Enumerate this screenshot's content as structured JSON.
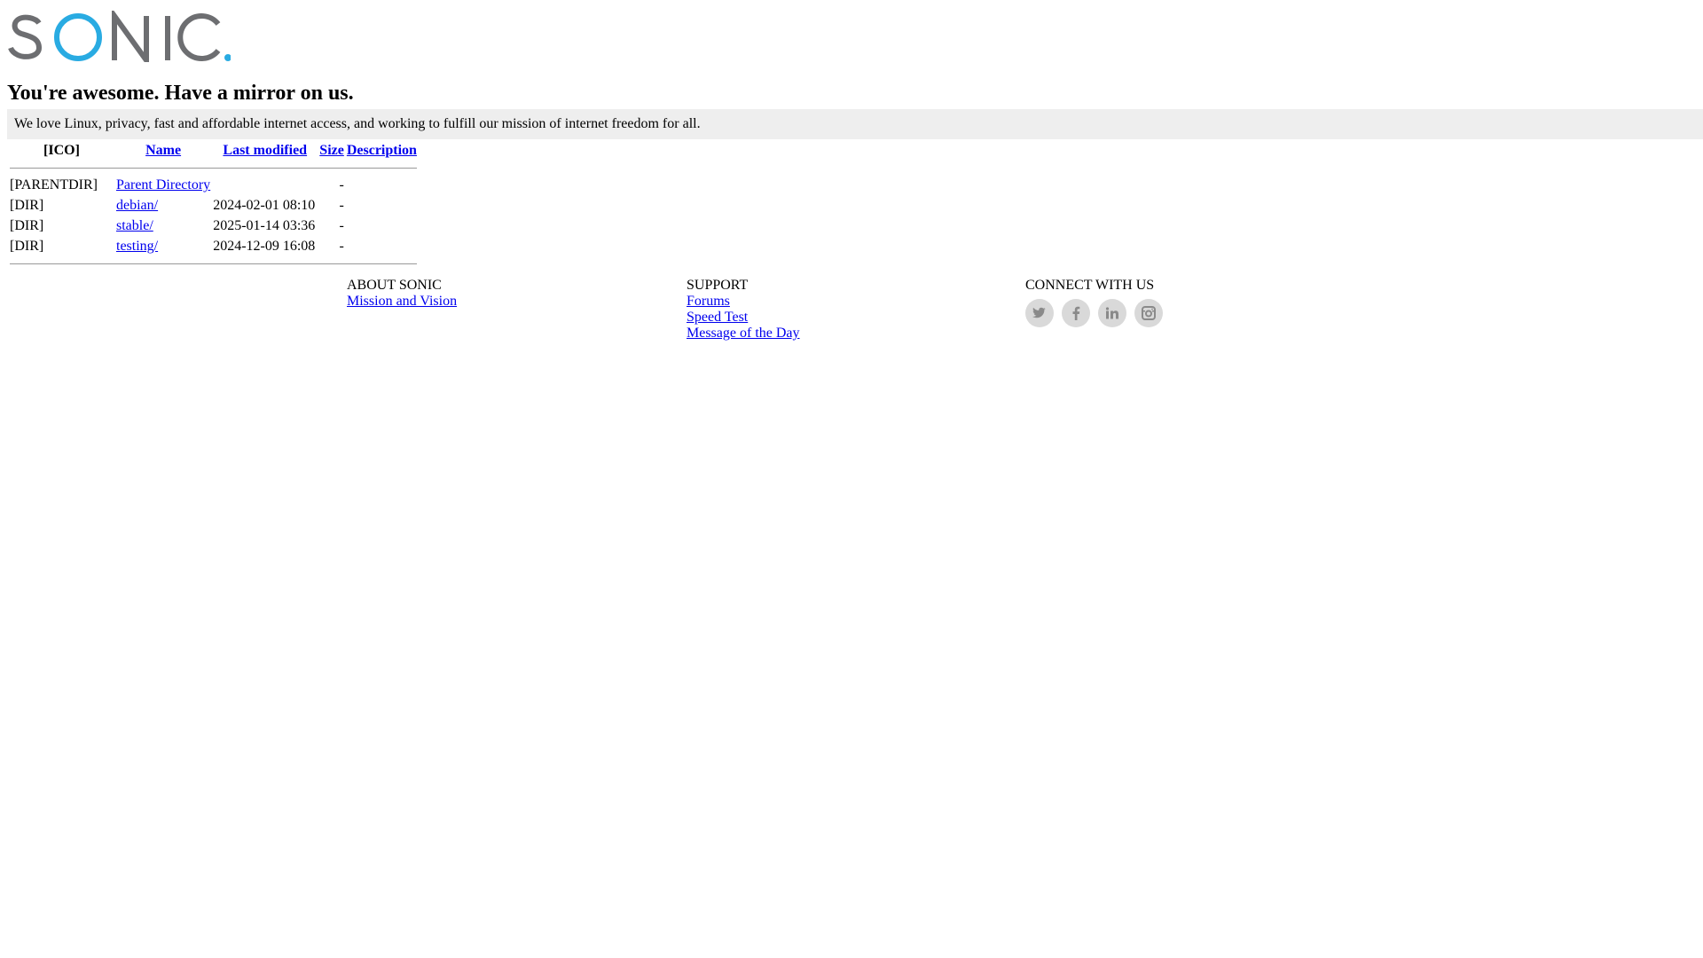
{
  "brand": {
    "logo_text": "SONIC.",
    "colors": {
      "gray": "#6d6e71",
      "accent": "#29abe2"
    }
  },
  "page": {
    "heading": "You're awesome. Have a mirror on us.",
    "tagline": "We love Linux, privacy, fast and affordable internet access, and working to fulfill our mission of internet freedom for all."
  },
  "listing": {
    "columns": {
      "icon": "[ICO]",
      "name": "Name",
      "last_modified": "Last modified",
      "size": "Size",
      "description": "Description"
    },
    "rows": [
      {
        "icon": "[PARENTDIR]",
        "name": "Parent Directory",
        "date": "",
        "size": "-"
      },
      {
        "icon": "[DIR]",
        "name": "debian/",
        "date": "2024-02-01 08:10",
        "size": "-"
      },
      {
        "icon": "[DIR]",
        "name": "stable/",
        "date": "2025-01-14 03:36",
        "size": "-"
      },
      {
        "icon": "[DIR]",
        "name": "testing/",
        "date": "2024-12-09 16:08",
        "size": "-"
      }
    ]
  },
  "footer": {
    "about": {
      "heading": "ABOUT SONIC",
      "links": [
        "Mission and Vision"
      ]
    },
    "support": {
      "heading": "SUPPORT",
      "links": [
        "Forums",
        "Speed Test",
        "Message of the Day"
      ]
    },
    "connect": {
      "heading": "CONNECT WITH US",
      "icons": [
        "twitter-icon",
        "facebook-icon",
        "linkedin-icon",
        "instagram-icon"
      ]
    }
  }
}
